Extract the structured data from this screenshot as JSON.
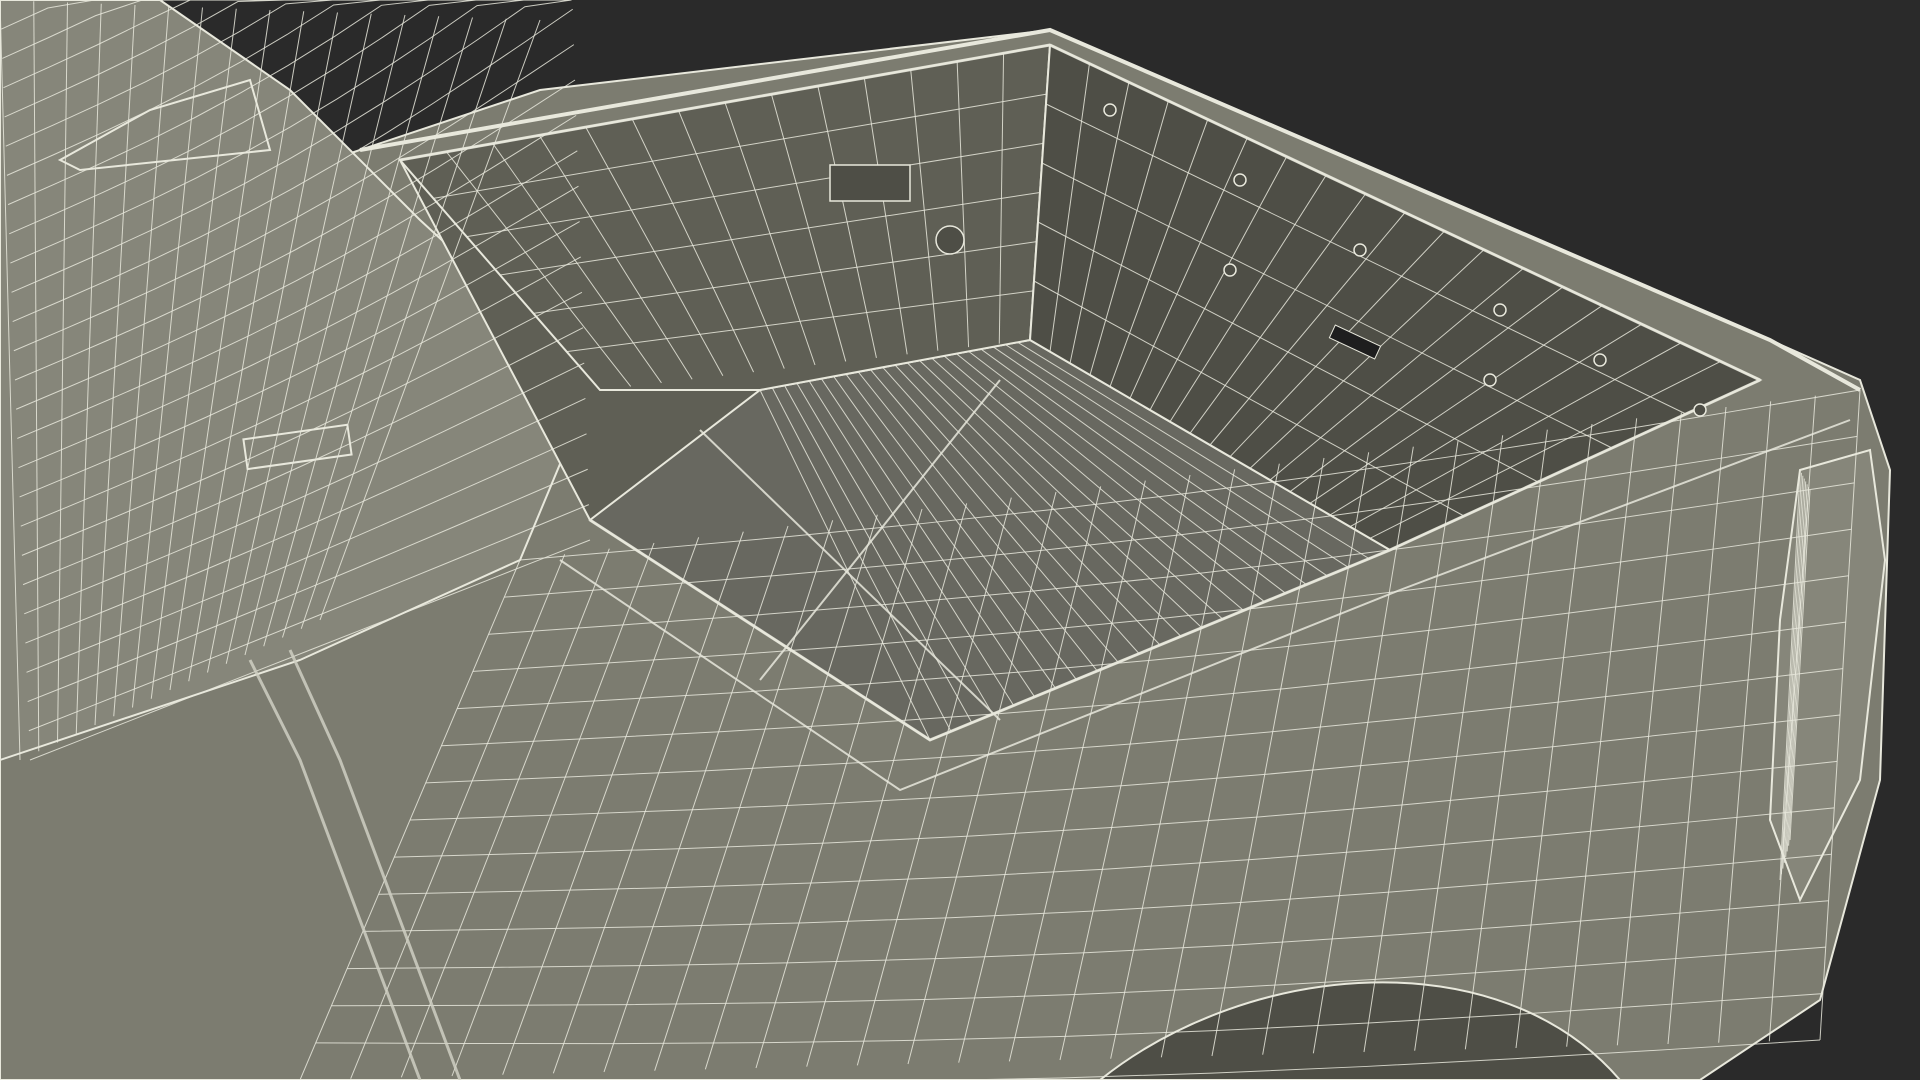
{
  "scene": {
    "subject": "pickup-truck-bed-wireframe",
    "colors": {
      "background": "#2a2a2a",
      "body": "#7c7c70",
      "body_light": "#86867a",
      "bed_inner": "#5f5f55",
      "bed_floor": "#686860",
      "bed_shadow": "#4e4e46",
      "wire": "#e8e8dc",
      "wire_dark": "#cfcfc2"
    },
    "grid": {
      "body_lon_lines": 26,
      "body_lat_lines": 30,
      "floor_ribs": 22,
      "wall_panels": 18
    }
  }
}
